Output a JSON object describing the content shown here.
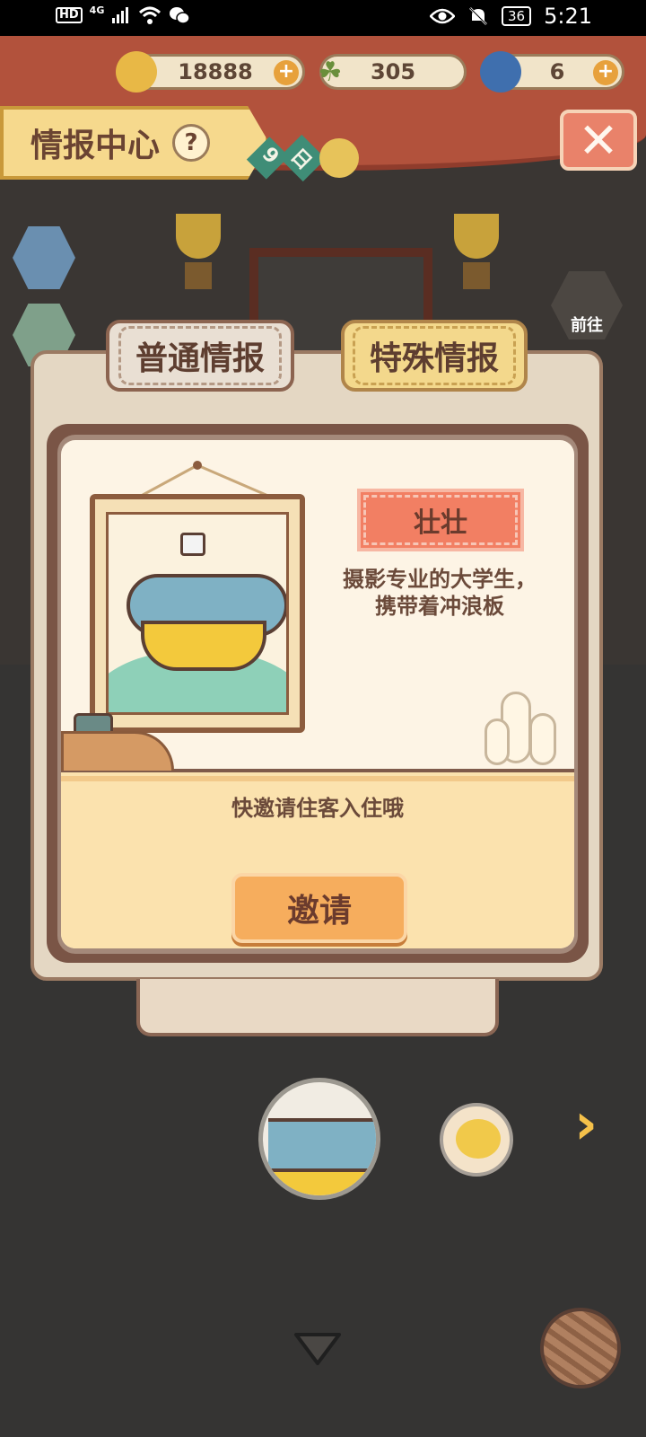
{
  "status_bar": {
    "hd": "HD",
    "network": "4G",
    "battery": "36",
    "time": "5:21"
  },
  "header": {
    "title": "情报中心",
    "help": "?",
    "close": "✕",
    "resources": [
      {
        "name": "coins",
        "icon": "coin-icon",
        "value": "18888"
      },
      {
        "name": "clover",
        "icon": "clover-icon",
        "value": "305"
      },
      {
        "name": "gem",
        "icon": "gem-icon",
        "value": "6"
      }
    ],
    "date_suffix": "日",
    "date_num": "9"
  },
  "side": {
    "goto_label": "前往"
  },
  "tabs": [
    {
      "label": "普通情报",
      "active": false
    },
    {
      "label": "特殊情报",
      "active": true
    }
  ],
  "card": {
    "name": "壮壮",
    "description_line1": "摄影专业的大学生，",
    "description_line2": "携带着冲浪板",
    "invite_hint": "快邀请住客入住哦",
    "invite_button": "邀请"
  },
  "colors": {
    "accent_orange": "#f6ad5d",
    "name_tag": "#f27f63",
    "tab_active": "#f3d88c",
    "awning": "#b2523c"
  }
}
